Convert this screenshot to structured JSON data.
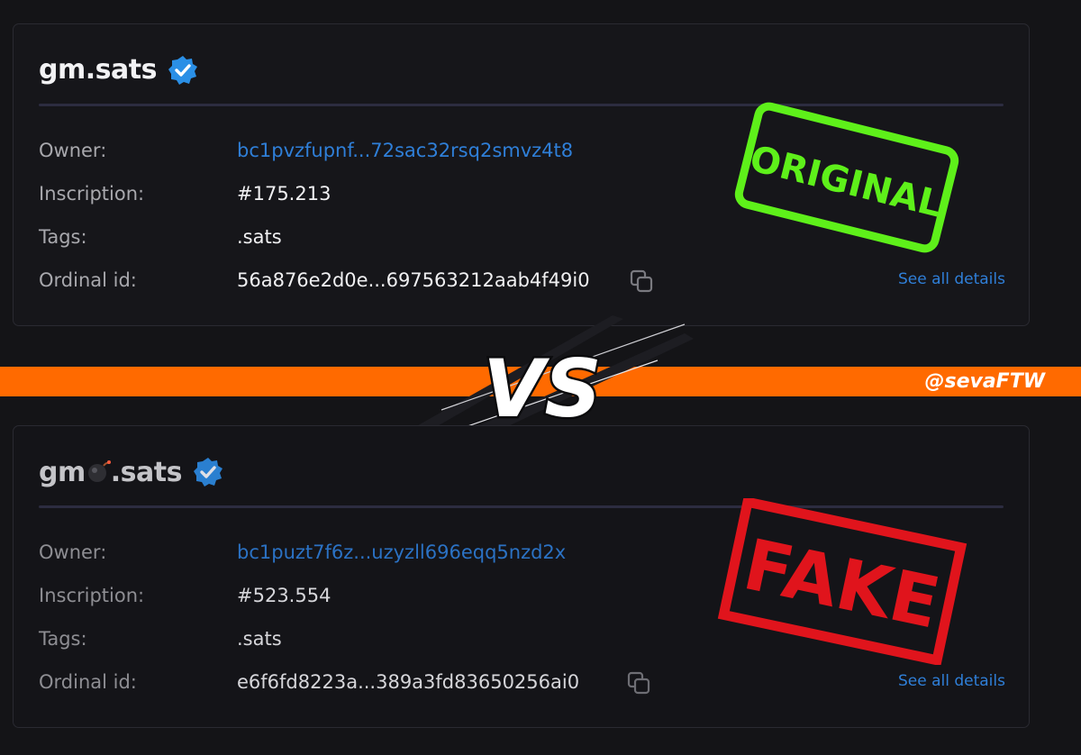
{
  "cards": [
    {
      "title": "gm.sats",
      "rows": [
        {
          "label": "Owner:",
          "value": "bc1pvzfupnf...72sac32rsq2smvz4t8"
        },
        {
          "label": "Inscription:",
          "value": "#175.213"
        },
        {
          "label": "Tags:",
          "value": ".sats"
        },
        {
          "label": "Ordinal id:",
          "value": "56a876e2d0e...697563212aab4f49i0"
        }
      ],
      "see_all": "See all details",
      "stamp": "ORIGINAL"
    },
    {
      "title_prefix": "gm",
      "title_suffix": ".sats",
      "rows": [
        {
          "label": "Owner:",
          "value": "bc1puzt7f6z...uzyzll696eqq5nzd2x"
        },
        {
          "label": "Inscription:",
          "value": "#523.554"
        },
        {
          "label": "Tags:",
          "value": ".sats"
        },
        {
          "label": "Ordinal id:",
          "value": "e6f6fd8223a...389a3fd83650256ai0"
        }
      ],
      "see_all": "See all details",
      "stamp": "FAKE"
    }
  ],
  "vs_label": "VS",
  "handle": "@sevaFTW",
  "colors": {
    "band": "#ff6a00",
    "link": "#2f7fd8",
    "verified": "#2a8fe6",
    "original_stamp": "#5ef01a",
    "fake_stamp": "#e0141c"
  },
  "icons": [
    "verified-badge-icon",
    "copy-icon",
    "bomb-emoji-icon"
  ]
}
